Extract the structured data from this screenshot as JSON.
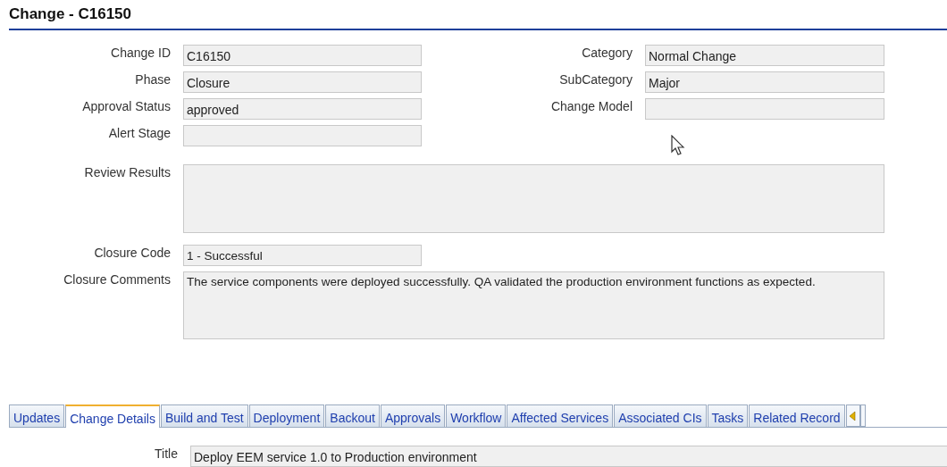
{
  "page_title": "Change - C16150",
  "fields": [
    {
      "label": "Change ID",
      "value": "C16150"
    },
    {
      "label": "Category",
      "value": "Normal Change"
    },
    {
      "label": "Phase",
      "value": "Closure"
    },
    {
      "label": "SubCategory",
      "value": "Major"
    },
    {
      "label": "Approval Status",
      "value": "approved"
    },
    {
      "label": "Change Model"
    },
    {
      "label": "Alert Stage"
    }
  ],
  "review_results": {
    "label": "Review Results"
  },
  "closure_code": {
    "label": "Closure Code",
    "value": "1 - Successful"
  },
  "closure_comments": {
    "label": "Closure Comments",
    "value": "The service components were deployed successfully. QA validated the production environment functions as expected."
  },
  "tabs": [
    {
      "label": "Updates",
      "selected": false
    },
    {
      "label": "Change Details",
      "selected": true
    },
    {
      "label": "Build and Test",
      "selected": false
    },
    {
      "label": "Deployment",
      "selected": false
    },
    {
      "label": "Backout",
      "selected": false
    },
    {
      "label": "Approvals",
      "selected": false
    },
    {
      "label": "Workflow",
      "selected": false
    },
    {
      "label": "Affected Services",
      "selected": false
    },
    {
      "label": "Associated CIs",
      "selected": false
    },
    {
      "label": "Tasks",
      "selected": false
    },
    {
      "label": "Related Record",
      "selected": false
    }
  ],
  "detail_title": {
    "label": "Title",
    "value": "Deploy EEM service 1.0 to Production environment"
  }
}
